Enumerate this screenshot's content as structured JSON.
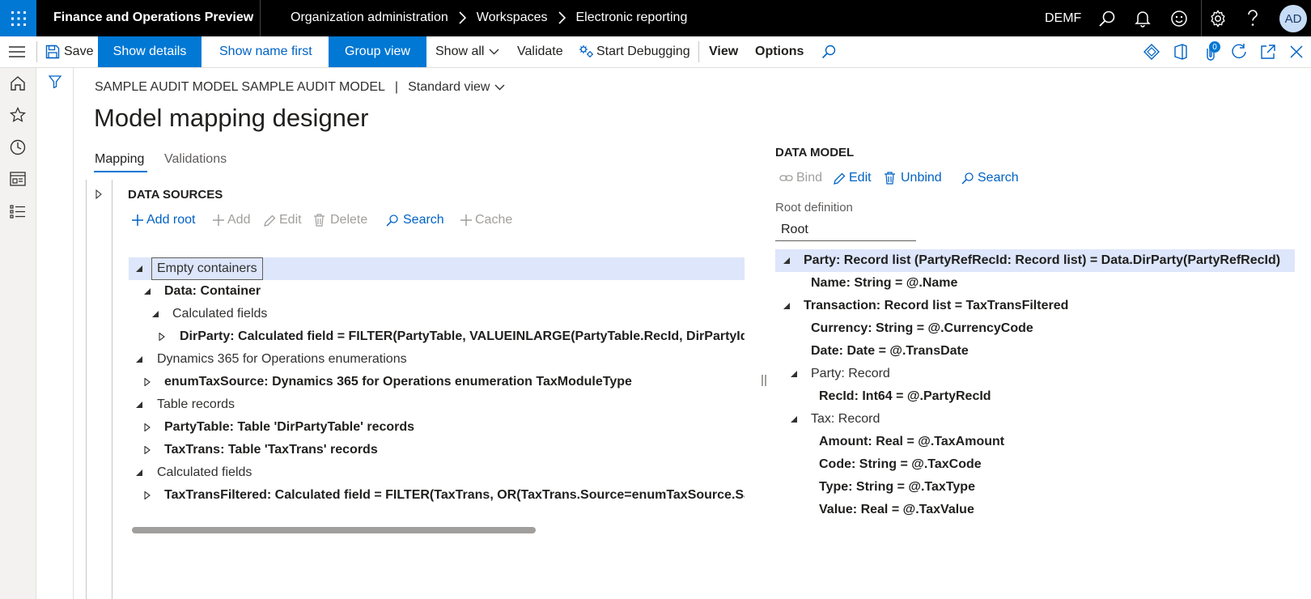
{
  "app": {
    "title": "Finance and Operations Preview",
    "company": "DEMF",
    "avatar_initials": "AD"
  },
  "breadcrumb": [
    "Organization administration",
    "Workspaces",
    "Electronic reporting"
  ],
  "actions": {
    "save": "Save",
    "show_details": "Show details",
    "show_name_first": "Show name first",
    "group_view": "Group view",
    "show_all": "Show all",
    "validate": "Validate",
    "start_debugging": "Start Debugging",
    "view": "View",
    "options": "Options",
    "notification_count": "0"
  },
  "page": {
    "context": "SAMPLE AUDIT MODEL SAMPLE AUDIT MODEL",
    "separator": "|",
    "view_name": "Standard view",
    "title": "Model mapping designer"
  },
  "tabs": [
    "Mapping",
    "Validations"
  ],
  "data_sources": {
    "heading": "DATA SOURCES",
    "toolbar": {
      "add_root": "Add root",
      "add": "Add",
      "edit": "Edit",
      "delete": "Delete",
      "search": "Search",
      "cache": "Cache"
    },
    "tree": [
      {
        "text": "Empty containers",
        "style": "n",
        "expanded": true,
        "selected": true
      },
      {
        "text": "Data: Container",
        "style": "b",
        "expanded": true
      },
      {
        "text": "Calculated fields",
        "style": "n",
        "expanded": true
      },
      {
        "text": "DirParty: Calculated field = FILTER(PartyTable, VALUEINLARGE(PartyTable.RecId, DirPartyId, DirPartyId",
        "style": "b",
        "expanded": false
      },
      {
        "text": "Dynamics 365 for Operations enumerations",
        "style": "n",
        "expanded": true
      },
      {
        "text": "enumTaxSource: Dynamics 365 for Operations enumeration TaxModuleType",
        "style": "b",
        "expanded": false
      },
      {
        "text": "Table records",
        "style": "n",
        "expanded": true
      },
      {
        "text": "PartyTable: Table 'DirPartyTable' records",
        "style": "b",
        "expanded": false
      },
      {
        "text": "TaxTrans: Table 'TaxTrans' records",
        "style": "b",
        "expanded": false
      },
      {
        "text": "Calculated fields",
        "style": "n",
        "expanded": true
      },
      {
        "text": "TaxTransFiltered: Calculated field = FILTER(TaxTrans, OR(TaxTrans.Source=enumTaxSource.Sales, TaxTr",
        "style": "b",
        "expanded": false
      }
    ]
  },
  "data_model": {
    "heading": "DATA MODEL",
    "toolbar": {
      "bind": "Bind",
      "edit": "Edit",
      "unbind": "Unbind",
      "search": "Search"
    },
    "root_label": "Root definition",
    "root_value": "Root",
    "tree": [
      {
        "text": "Party: Record list (PartyRefRecId: Record list) = Data.DirParty(PartyRefRecId)",
        "style": "b",
        "toggle": "expanded",
        "selected": true
      },
      {
        "text": "Name: String = @.Name",
        "style": "b",
        "toggle": "none"
      },
      {
        "text": "Transaction: Record list = TaxTransFiltered",
        "style": "b",
        "toggle": "expanded"
      },
      {
        "text": "Currency: String = @.CurrencyCode",
        "style": "b",
        "toggle": "none"
      },
      {
        "text": "Date: Date = @.TransDate",
        "style": "b",
        "toggle": "none"
      },
      {
        "text": "Party: Record",
        "style": "n",
        "toggle": "expanded"
      },
      {
        "text": "RecId: Int64 = @.PartyRecId",
        "style": "b",
        "toggle": "none"
      },
      {
        "text": "Tax: Record",
        "style": "n",
        "toggle": "expanded"
      },
      {
        "text": "Amount: Real = @.TaxAmount",
        "style": "b",
        "toggle": "none"
      },
      {
        "text": "Code: String = @.TaxCode",
        "style": "b",
        "toggle": "none"
      },
      {
        "text": "Type: String = @.TaxType",
        "style": "b",
        "toggle": "none"
      },
      {
        "text": "Value: Real = @.TaxValue",
        "style": "b",
        "toggle": "none"
      }
    ]
  },
  "colors": {
    "accent": "#0078d4",
    "link": "#0062c4",
    "disabled": "#a19f9d",
    "selected_row": "#dde6fa",
    "topbar": "#000000"
  }
}
